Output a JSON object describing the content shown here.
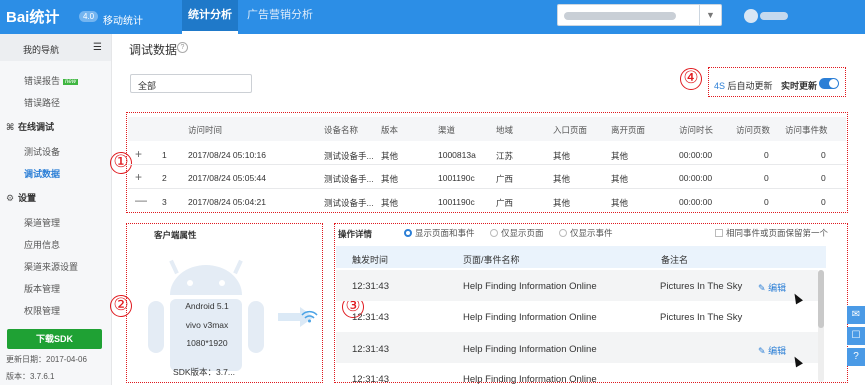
{
  "topbar": {
    "logo": "Bai统计",
    "version": "4.0",
    "subtitle": "移动统计",
    "tabs": [
      {
        "label": "统计分析"
      },
      {
        "label": "广告营销分析"
      }
    ],
    "dropdown_arrow": "chevron-down-icon"
  },
  "sidebar": {
    "header": "我的导航",
    "items": [
      {
        "label": "错误报告",
        "badge": "new"
      },
      {
        "label": "错误路径"
      }
    ],
    "sections": [
      {
        "title": "在线调试",
        "items": [
          {
            "label": "测试设备"
          },
          {
            "label": "调试数据"
          }
        ]
      },
      {
        "title": "设置",
        "items": [
          {
            "label": "渠道管理"
          },
          {
            "label": "应用信息"
          },
          {
            "label": "渠道来源设置"
          },
          {
            "label": "版本管理"
          },
          {
            "label": "权限管理"
          }
        ]
      }
    ],
    "download": "下载SDK",
    "update_date": "更新日期：2017-04-06",
    "version": "版本：3.7.6.1"
  },
  "main": {
    "title": "调试数据",
    "filter": "全部",
    "auto_refresh_seconds": "4S",
    "auto_refresh_label": "后自动更新",
    "realtime_label": "实时更新",
    "realtime_on": true
  },
  "markers": [
    "①",
    "②",
    "③",
    "④"
  ],
  "device_table": {
    "headers": [
      "访问时间",
      "设备名称",
      "版本",
      "渠道",
      "地域",
      "入口页面",
      "离开页面",
      "访问时长",
      "访问页数",
      "访问事件数"
    ],
    "rows": [
      {
        "expander": "+",
        "index": "1",
        "time": "2017/08/24 05:10:16",
        "device": "测试设备手...",
        "version": "其他",
        "channel": "1000813a",
        "region": "江苏",
        "entry": "其他",
        "exit": "其他",
        "duration": "00:00:00",
        "pages": "0",
        "events": "0"
      },
      {
        "expander": "+",
        "index": "2",
        "time": "2017/08/24 05:05:44",
        "device": "测试设备手...",
        "version": "其他",
        "channel": "1001190c",
        "region": "广西",
        "entry": "其他",
        "exit": "其他",
        "duration": "00:00:00",
        "pages": "0",
        "events": "0"
      },
      {
        "expander": "—",
        "index": "3",
        "time": "2017/08/24 05:04:21",
        "device": "测试设备手...",
        "version": "其他",
        "channel": "1001190c",
        "region": "广西",
        "entry": "其他",
        "exit": "其他",
        "duration": "00:00:00",
        "pages": "0",
        "events": "0"
      }
    ]
  },
  "client": {
    "title": "客户端属性",
    "os": "Android 5.1",
    "model": "vivo v3max",
    "resolution": "1080*1920",
    "sdk": "SDK版本：3.7..."
  },
  "detail": {
    "title": "操作详情",
    "radios": [
      {
        "label": "显示页面和事件",
        "checked": true
      },
      {
        "label": "仅显示页面",
        "checked": false
      },
      {
        "label": "仅显示事件",
        "checked": false
      }
    ],
    "checkbox": "相同事件或页面保留第一个",
    "headers": [
      "触发时间",
      "页面/事件名称",
      "备注名"
    ],
    "edit_label": "编辑",
    "rows": [
      {
        "time": "12:31:43",
        "name": "Help Finding Information Online",
        "note": "Pictures In The Sky",
        "editable": true
      },
      {
        "time": "12:31:43",
        "name": "Help Finding Information Online",
        "note": "Pictures In The Sky",
        "editable": false
      },
      {
        "time": "12:31:43",
        "name": "Help Finding Information Online",
        "note": "",
        "editable": true
      },
      {
        "time": "12:31:43",
        "name": "Help Finding Information Online",
        "note": "",
        "editable": false
      }
    ]
  },
  "colors": {
    "brand": "#2c8ee6",
    "accent": "#2c7fd6",
    "annotation": "#e0191e",
    "download": "#1fa134"
  }
}
